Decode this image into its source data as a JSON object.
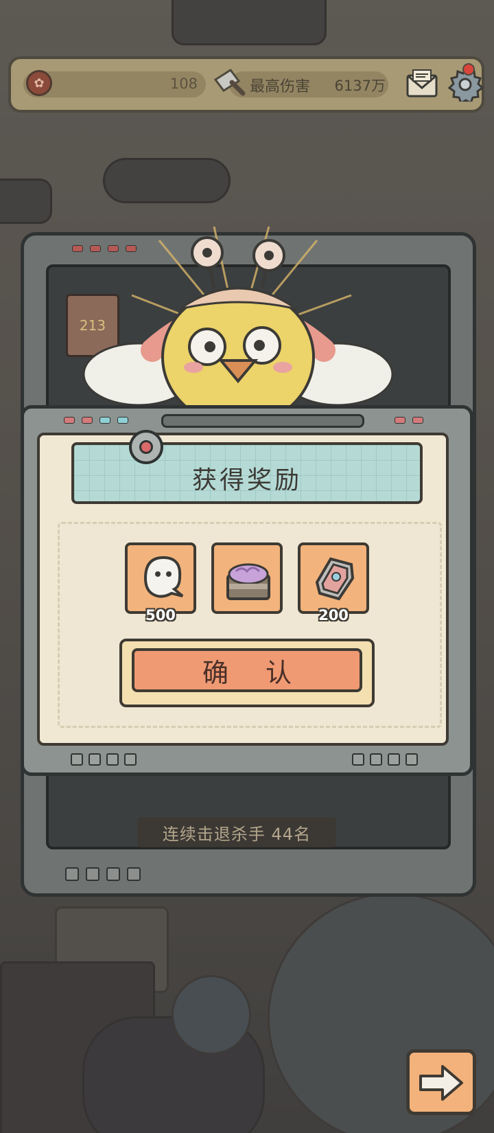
{
  "top_bar": {
    "coin_value": "108",
    "max_damage_label": "最高伤害",
    "max_damage_value": "6137万",
    "icons": [
      "coin-icon",
      "cleaver-icon",
      "mail-icon",
      "gear-icon"
    ]
  },
  "background": {
    "rank_badge_text": "213",
    "kill_streak_text": "连续击退杀手  44名"
  },
  "dialog": {
    "title": "获得奖励",
    "rewards": [
      {
        "icon": "ghost-icon",
        "count": "500"
      },
      {
        "icon": "treasure-chest-icon",
        "count": ""
      },
      {
        "icon": "coffin-icon",
        "count": "200"
      }
    ],
    "confirm_label": "确认"
  },
  "next_button": {
    "icon": "arrow-right-icon"
  },
  "colors": {
    "title_plate": "#b5dad5",
    "reward_tile": "#f2b37c",
    "confirm_face": "#ef9a73",
    "paper": "#f1e8d4",
    "frame": "#2f3333"
  }
}
